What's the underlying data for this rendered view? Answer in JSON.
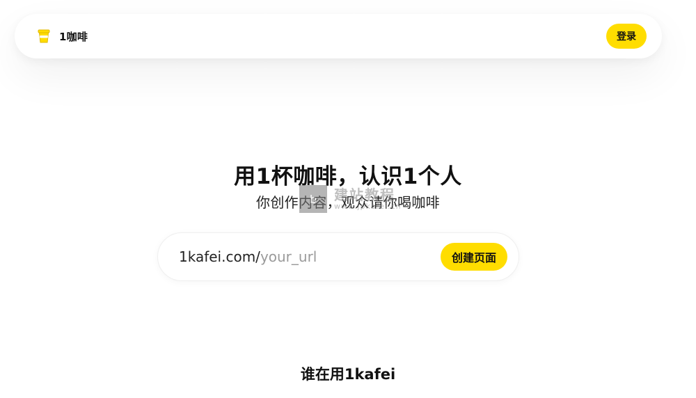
{
  "header": {
    "brand_name": "1咖啡",
    "brand_icon": "coffee-cup-icon",
    "login_label": "登录"
  },
  "hero": {
    "title": "用1杯咖啡，认识1个人",
    "subtitle": "你创作内容，观众请你喝咖啡"
  },
  "url_form": {
    "prefix": "1kafei.com/",
    "placeholder": "your_url",
    "value": "",
    "create_label": "创建页面"
  },
  "watermark": {
    "badge": "b",
    "title": "建站教程",
    "url": "www.jpkafei.cn"
  },
  "section": {
    "heading": "谁在用1kafei"
  },
  "colors": {
    "accent": "#ffdd00",
    "text": "#111111",
    "placeholder": "#9a9a9a"
  }
}
